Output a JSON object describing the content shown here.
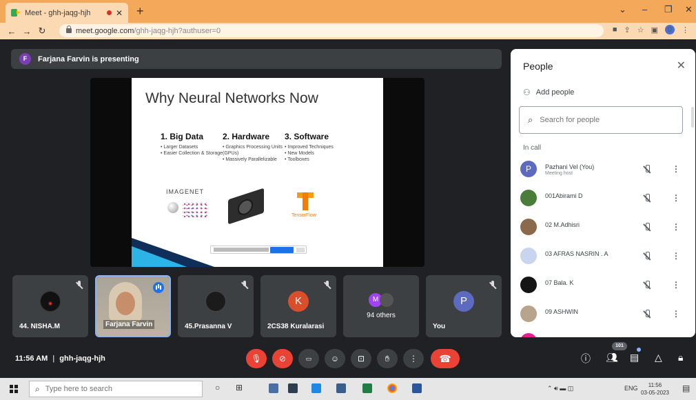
{
  "browser": {
    "tab_title": "Meet - ghh-jaqg-hjh",
    "url_host": "meet.google.com",
    "url_path": "/ghh-jaqg-hjh?authuser=0",
    "profile_initial": "0"
  },
  "presenting": {
    "initial": "F",
    "text": "Farjana Farvin is presenting"
  },
  "slide": {
    "title": "Why Neural Networks Now",
    "columns": [
      {
        "heading": "1. Big Data",
        "bullets": [
          "Larger Datasets",
          "Easier Collection & Storage"
        ]
      },
      {
        "heading": "2. Hardware",
        "bullets": [
          "Graphics Processing Units (GPUs)",
          "Massively Parallelizable"
        ]
      },
      {
        "heading": "3. Software",
        "bullets": [
          "Improved Techniques",
          "New Models",
          "Toolboxes"
        ]
      }
    ],
    "imagenet_label": "IMAGENET",
    "tensorflow_label": "TensorFlow"
  },
  "tiles": [
    {
      "name": "44. NISHA.M"
    },
    {
      "name": "Farjana Farvin"
    },
    {
      "name": "45.Prasanna V"
    },
    {
      "name": "2CS38 Kuralarasi",
      "initial": "K"
    },
    {
      "name": "94 others",
      "initial": "M"
    },
    {
      "name": "You",
      "initial": "P"
    }
  ],
  "controls": {
    "time": "11:56 AM",
    "separator": "|",
    "meeting_code": "ghh-jaqg-hjh",
    "participant_count": "101"
  },
  "people": {
    "title": "People",
    "add_people": "Add people",
    "search_placeholder": "Search for people",
    "section_label": "In call",
    "list": [
      {
        "name": "Pazhani Vel (You)",
        "sub": "Meeting host",
        "initial": "P"
      },
      {
        "name": "001Abirami D",
        "sub": ""
      },
      {
        "name": "02 M.Adhisri",
        "sub": ""
      },
      {
        "name": "03 AFRAS NASRIN . A",
        "sub": ""
      },
      {
        "name": "07 Bala. K",
        "sub": ""
      },
      {
        "name": "09 ASHWIN",
        "sub": ""
      }
    ]
  },
  "taskbar": {
    "search_placeholder": "Type here to search",
    "lang": "ENG",
    "time": "11:56",
    "date": "03-05-2023"
  },
  "colors": {
    "meet_bg": "#202124",
    "tile_bg": "#3c4043",
    "hangup_red": "#ea4335",
    "accent_blue": "#1a73e8"
  }
}
